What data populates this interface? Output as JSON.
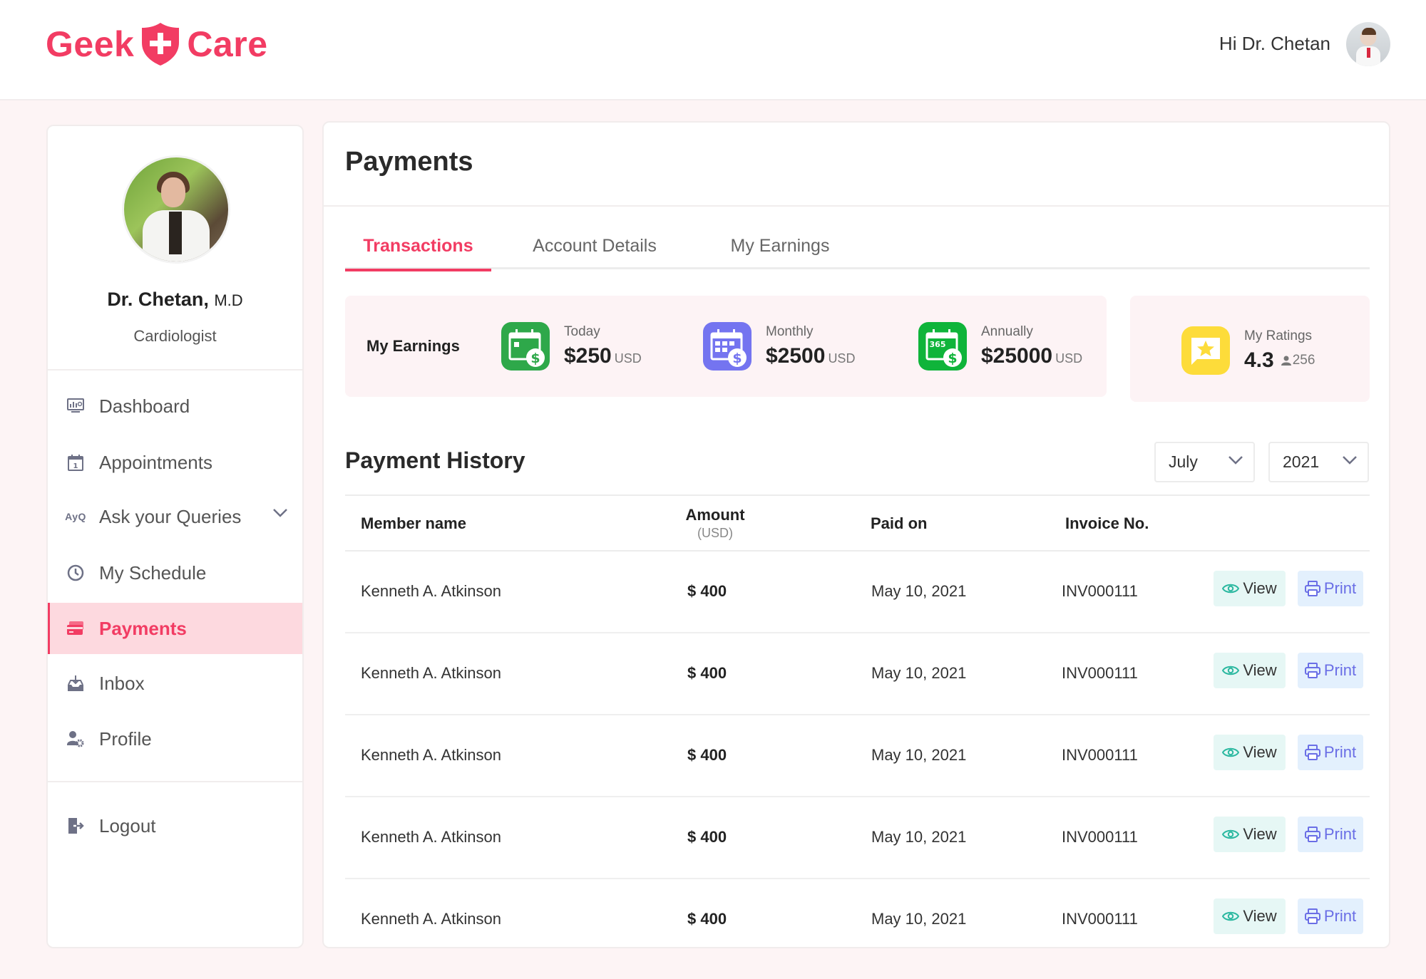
{
  "header": {
    "brand_left": "Geek",
    "brand_right": "Care",
    "greeting": "Hi Dr. Chetan",
    "brand_color": "#f23c63"
  },
  "sidebar": {
    "doctor_name": "Dr. Chetan,",
    "doctor_suffix": "M.D",
    "specialty": "Cardiologist",
    "items": [
      {
        "label": "Dashboard",
        "icon": "dashboard-monitor-icon"
      },
      {
        "label": "Appointments",
        "icon": "calendar-icon"
      },
      {
        "label": "Ask your Queries",
        "icon": "ayq-icon",
        "expandable": true,
        "icon_text": "AyQ"
      },
      {
        "label": "My Schedule",
        "icon": "clock-icon"
      },
      {
        "label": "Payments",
        "icon": "credit-card-icon",
        "active": true
      },
      {
        "label": "Inbox",
        "icon": "inbox-download-icon"
      },
      {
        "label": "Profile",
        "icon": "user-settings-icon"
      }
    ],
    "logout_label": "Logout"
  },
  "main": {
    "title": "Payments",
    "tabs": [
      {
        "label": "Transactions",
        "active": true
      },
      {
        "label": "Account Details",
        "active": false
      },
      {
        "label": "My Earnings",
        "active": false
      }
    ],
    "earnings": {
      "label": "My Earnings",
      "stats": [
        {
          "label": "Today",
          "value": "$250",
          "unit": "USD",
          "icon": "calendar-dollar-icon",
          "color": "#2ea84a"
        },
        {
          "label": "Monthly",
          "value": "$2500",
          "unit": "USD",
          "icon": "calendar-grid-dollar-icon",
          "color": "#7474f0"
        },
        {
          "label": "Annually",
          "value": "$25000",
          "unit": "USD",
          "icon": "calendar-365-dollar-icon",
          "color": "#0fb43a",
          "icon_text": "365"
        }
      ]
    },
    "ratings": {
      "label": "My Ratings",
      "value": "4.3",
      "count": "256",
      "icon": "star-message-icon",
      "color": "#fddc3a"
    },
    "history": {
      "title": "Payment History",
      "month": "July",
      "year": "2021",
      "columns": {
        "member": "Member name",
        "amount": "Amount",
        "amount_unit": "(USD)",
        "paid_on": "Paid on",
        "invoice": "Invoice No."
      },
      "view_label": "View",
      "print_label": "Print",
      "rows": [
        {
          "member": "Kenneth A. Atkinson",
          "amount": "$ 400",
          "paid_on": "May 10, 2021",
          "invoice": "INV000111"
        },
        {
          "member": "Kenneth A. Atkinson",
          "amount": "$ 400",
          "paid_on": "May 10, 2021",
          "invoice": "INV000111"
        },
        {
          "member": "Kenneth A. Atkinson",
          "amount": "$ 400",
          "paid_on": "May 10, 2021",
          "invoice": "INV000111"
        },
        {
          "member": "Kenneth A. Atkinson",
          "amount": "$ 400",
          "paid_on": "May 10, 2021",
          "invoice": "INV000111"
        },
        {
          "member": "Kenneth A. Atkinson",
          "amount": "$ 400",
          "paid_on": "May 10, 2021",
          "invoice": "INV000111"
        }
      ]
    }
  }
}
